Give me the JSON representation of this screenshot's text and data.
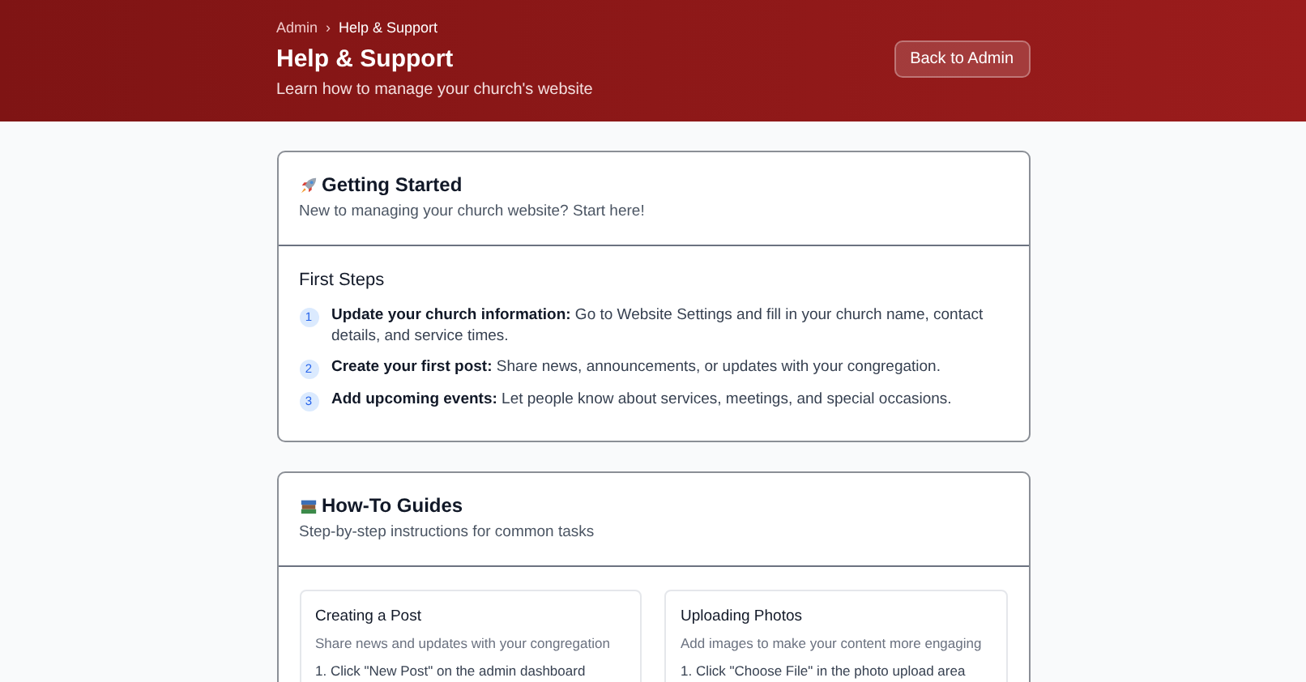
{
  "header": {
    "breadcrumb": [
      "Admin",
      "Help & Support"
    ],
    "separator": "›",
    "title": "Help & Support",
    "subtitle": "Learn how to manage your church's website",
    "back_button": "Back to Admin"
  },
  "sections": [
    {
      "kind": "steps",
      "title": "Getting Started",
      "subtitle": "New to managing your church website? Start here!",
      "body_title": "First Steps",
      "steps": [
        {
          "number": "1",
          "text": "**Update your church information:** Go to Website Settings and fill in your church name, contact details, and service times."
        },
        {
          "number": "2",
          "text": "**Create your first post:** Share news, announcements, or updates with your congregation."
        },
        {
          "number": "3",
          "text": "**Add upcoming events:** Let people know about services, meetings, and special occasions."
        }
      ]
    },
    {
      "kind": "guides",
      "title": "How-To Guides",
      "subtitle": "Step-by-step instructions for common tasks",
      "guides": [
        {
          "title": "Creating a Post",
          "description": "Share news and updates with your congregation",
          "lines": [
            "1. Click \"New Post\" on the admin dashboard"
          ]
        },
        {
          "title": "Uploading Photos",
          "description": "Add images to make your content more engaging",
          "lines": [
            "1. Click \"Choose File\" in the photo upload area"
          ]
        }
      ]
    }
  ]
}
